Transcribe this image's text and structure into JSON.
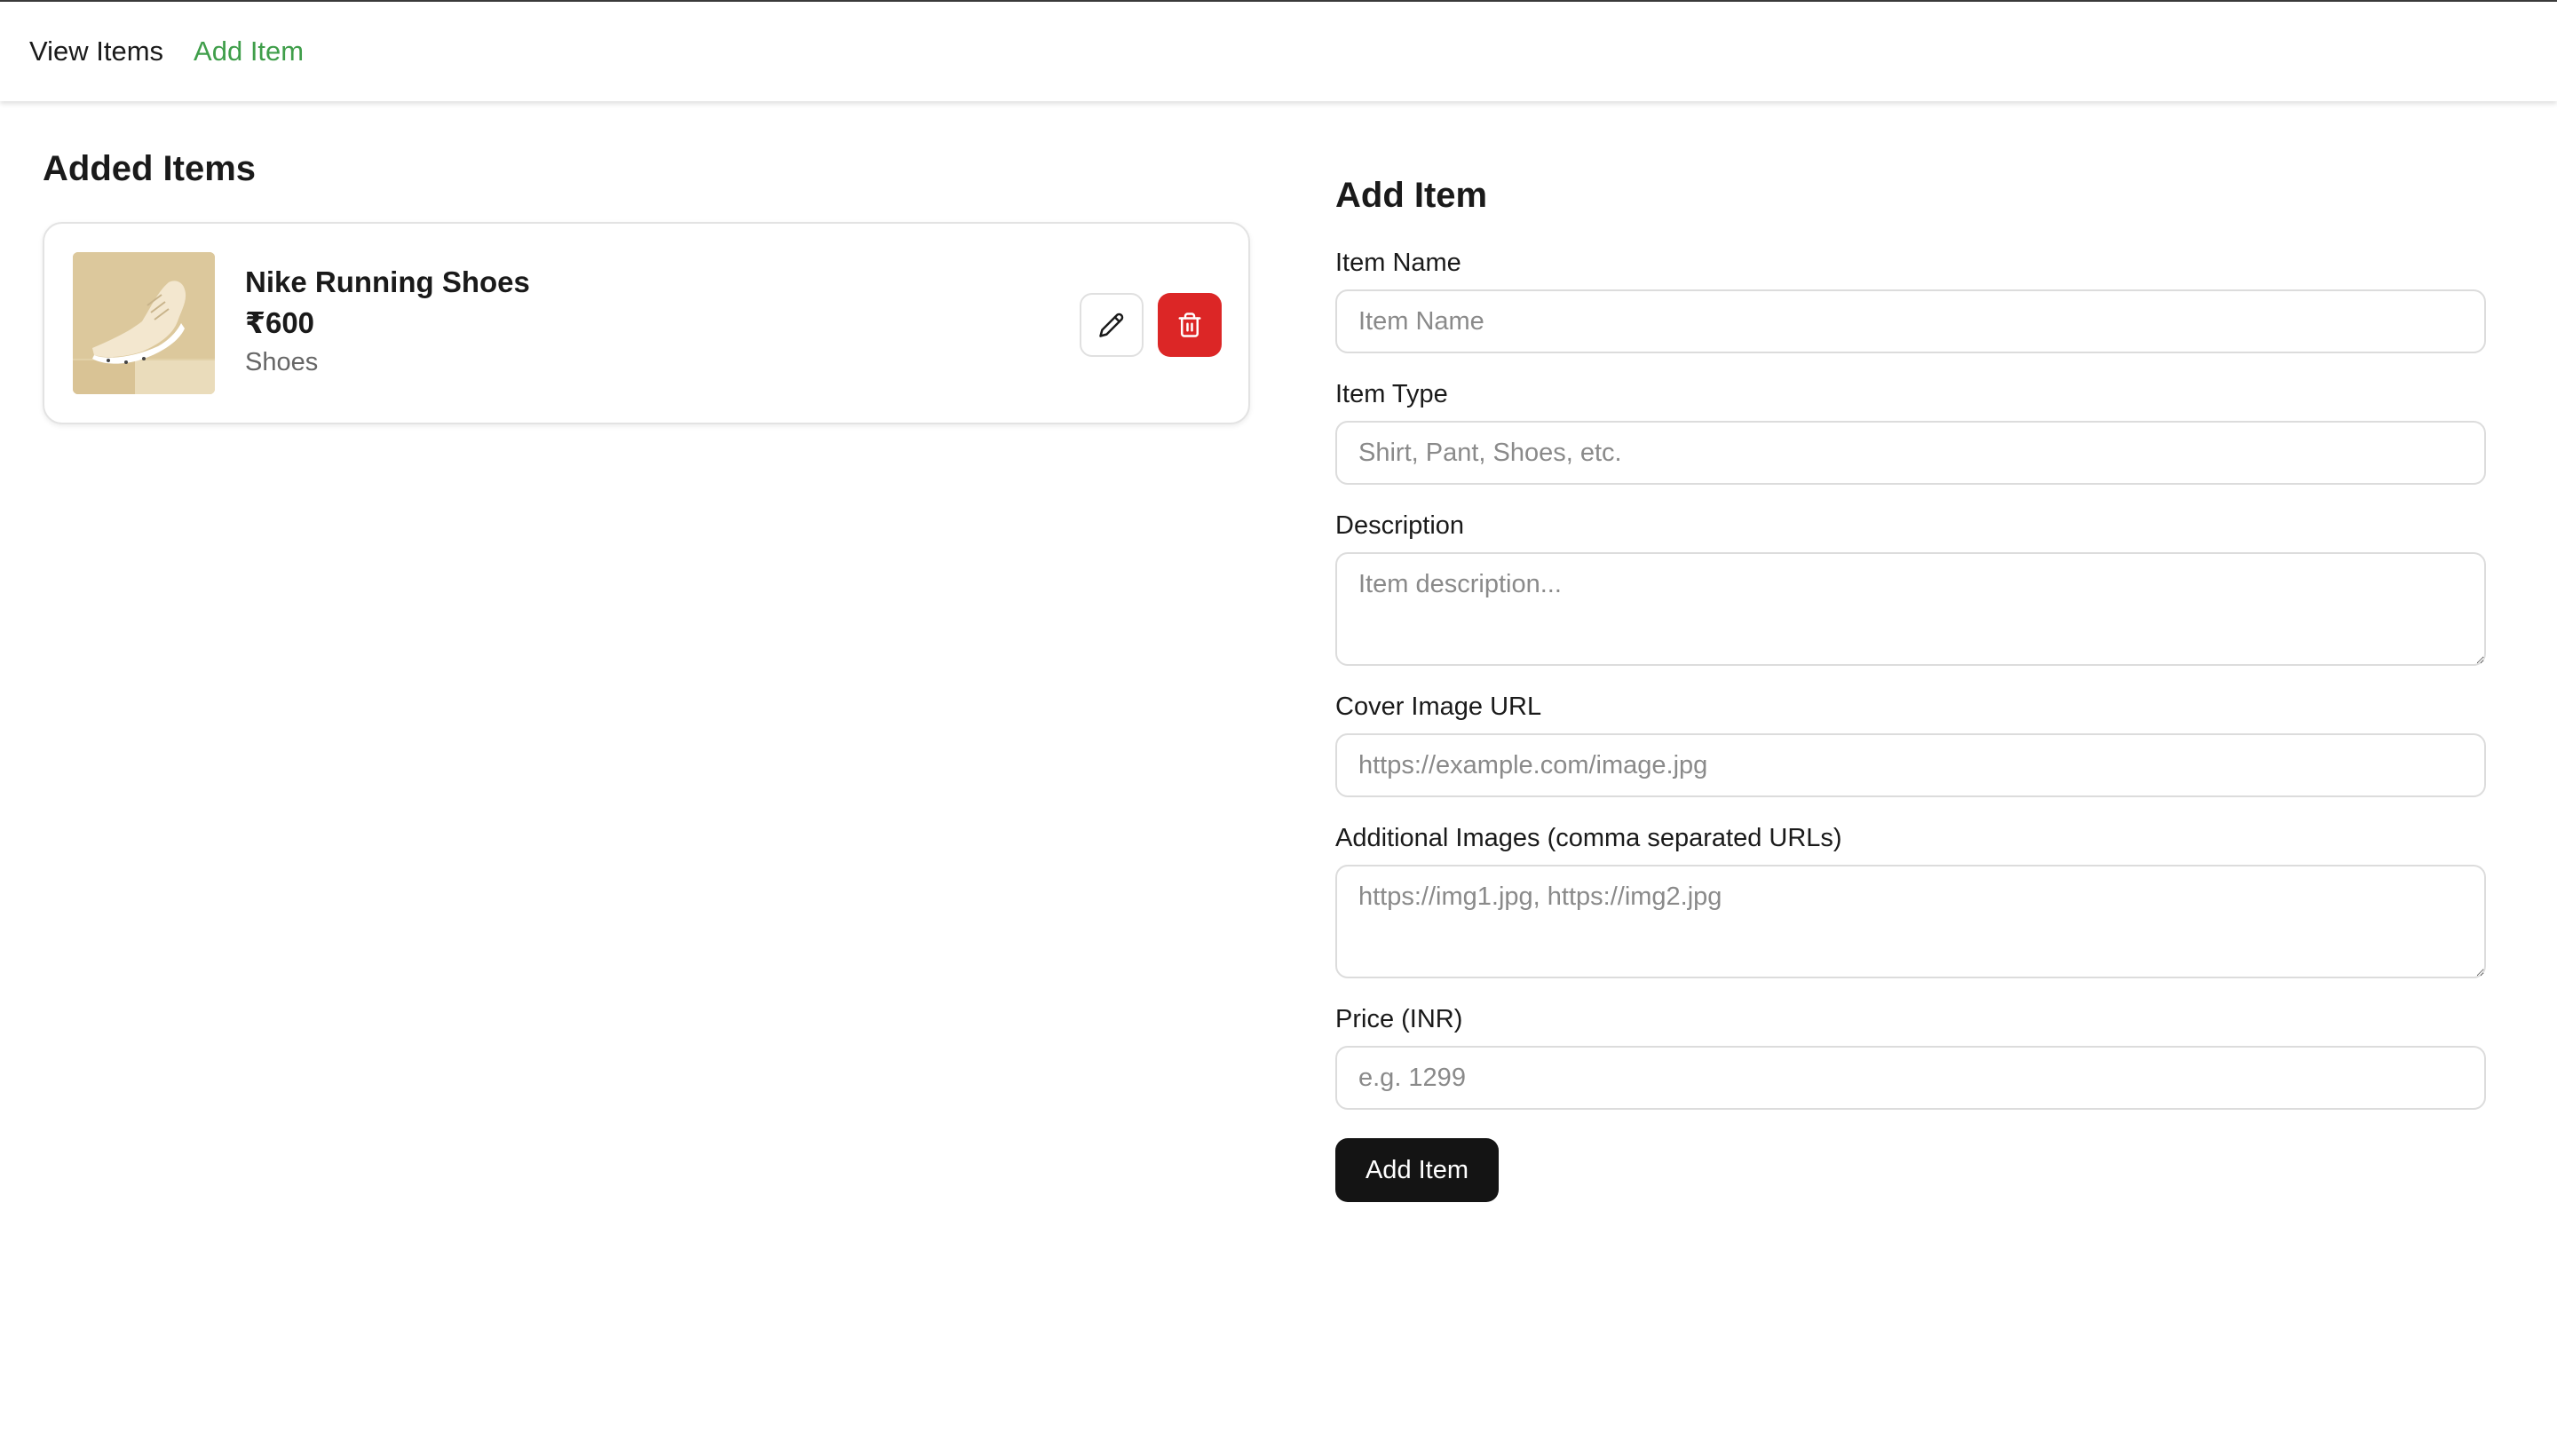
{
  "nav": {
    "view_items": "View Items",
    "add_item": "Add Item"
  },
  "added_items": {
    "title": "Added Items",
    "items": [
      {
        "name": "Nike Running Shoes",
        "price": "₹600",
        "type": "Shoes",
        "image_icon": "shoe-thumbnail"
      }
    ]
  },
  "form": {
    "title": "Add Item",
    "fields": {
      "name": {
        "label": "Item Name",
        "placeholder": "Item Name",
        "value": ""
      },
      "type": {
        "label": "Item Type",
        "placeholder": "Shirt, Pant, Shoes, etc.",
        "value": ""
      },
      "description": {
        "label": "Description",
        "placeholder": "Item description...",
        "value": ""
      },
      "cover_image": {
        "label": "Cover Image URL",
        "placeholder": "https://example.com/image.jpg",
        "value": ""
      },
      "additional_images": {
        "label": "Additional Images (comma separated URLs)",
        "placeholder": "https://img1.jpg, https://img2.jpg",
        "value": ""
      },
      "price": {
        "label": "Price (INR)",
        "placeholder": "e.g. 1299",
        "value": ""
      }
    },
    "submit_label": "Add Item"
  },
  "colors": {
    "accent_green": "#3f9e4a",
    "delete_red": "#dc2626",
    "primary_button": "#141414"
  }
}
